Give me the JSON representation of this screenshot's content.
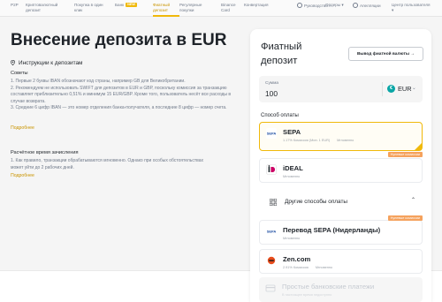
{
  "nav": {
    "items": [
      {
        "label": "P2P",
        "x_key": "p2p"
      },
      {
        "label": "Криптовалютный депозит",
        "x_key": "crypto"
      },
      {
        "label": "Покупка в один клик",
        "x_key": "oneclick"
      },
      {
        "label": "Банк",
        "x_key": "bank",
        "badge": "NEW"
      },
      {
        "label": "Фиатный депозит",
        "x_key": "fiat",
        "active": true
      },
      {
        "label": "Регулярные покупки",
        "x_key": "recurring"
      },
      {
        "label": "Binance Card",
        "x_key": "card"
      },
      {
        "label": "Конвертация",
        "x_key": "convert"
      },
      {
        "label": "Руководство",
        "x_key": "guide"
      },
      {
        "label": "Ордеры",
        "x_key": "orders"
      },
      {
        "label": "Апелляции",
        "x_key": "appeals"
      },
      {
        "label": "Центр пользователя",
        "x_key": "user"
      }
    ]
  },
  "page": {
    "title": "Внесение депозита в EUR",
    "instructions_heading": "Инструкции к депозитам",
    "tips_label": "Советы",
    "tips": [
      "1. Первые 2 буквы IBAN обозначают код страны, например GB для Великобритании.",
      "2. Рекомендуем не использовать SWIFT для депозитов в EUR и GBP, поскольку комиссия за транзакцию составляет приблизительно 0,51% и минимум 15 EUR/GBP. Кроме того, пользователь несёт все расходы в случае возврата.",
      "3. Средние 6 цифр IBAN — это номер отделения банка-получателя, а последние 8 цифр — номер счета."
    ],
    "more_link": "Подробнее",
    "time_label": "Расчётное время зачисления",
    "time_items": [
      "1. Как правило, транзакции обрабатываются мгновенно. Однако при особых обстоятельствах может уйти до 2 рабочих дней."
    ],
    "more_link_2": "Подробнее"
  },
  "card": {
    "title": "Фиатный депозит",
    "withdraw_button": "Вывод фиатной валюты →",
    "amount_label": "Сумма",
    "amount_value": "100",
    "currency": "EUR",
    "currency_symbol": "€",
    "pay_label": "Способ оплаты",
    "methods": [
      {
        "name": "SEPA",
        "meta": [
          "1.17% Комиссия (Мин. 1 EUR)",
          "Мгновенно"
        ],
        "selected": true,
        "tag": "Нулевые комиссии"
      },
      {
        "name": "iDEAL",
        "meta": [
          "Мгновенно"
        ],
        "selected": false,
        "tag": ""
      }
    ],
    "other_methods": "Другие способы оплаты",
    "more_methods": [
      {
        "name": "Перевод SEPA (Нидерланды)",
        "meta": [
          "Мгновенно"
        ],
        "tag": "Нулевые комиссии"
      },
      {
        "name": "Zen.com",
        "meta": [
          "2.91% Комиссия",
          "Мгновенно"
        ],
        "tag": ""
      }
    ],
    "disabled_method": {
      "name": "Простые банковские платежи",
      "meta": "В настоящее время недоступно"
    }
  },
  "colors": {
    "accent": "#f0b90b",
    "link": "#c99400",
    "tag": "#f5a25d",
    "eur": "#0aa6a6"
  }
}
